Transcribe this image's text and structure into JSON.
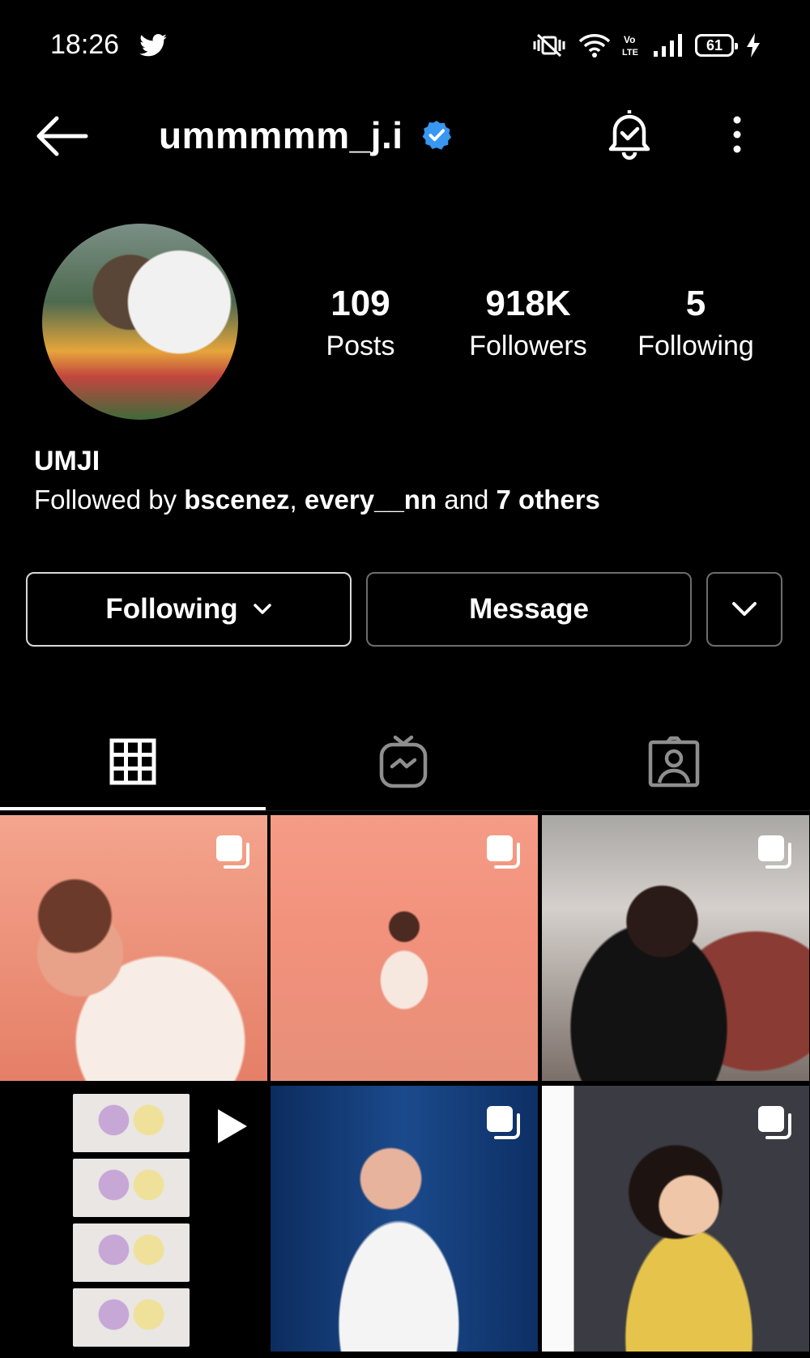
{
  "status_bar": {
    "time": "18:26",
    "battery": "61"
  },
  "header": {
    "username": "ummmmm_j.i"
  },
  "profile": {
    "stats": [
      {
        "value": "109",
        "label": "Posts"
      },
      {
        "value": "918K",
        "label": "Followers"
      },
      {
        "value": "5",
        "label": "Following"
      }
    ],
    "display_name": "UMJI",
    "followed_by": {
      "prefix": "Followed by ",
      "user1": "bscenez",
      "sep": ", ",
      "user2": "every__nn",
      "and": " and ",
      "others": "7 others"
    }
  },
  "actions": {
    "following_label": "Following",
    "message_label": "Message"
  },
  "tabs": [
    {
      "icon": "grid-icon",
      "selected": true
    },
    {
      "icon": "igtv-icon",
      "selected": false
    },
    {
      "icon": "tagged-icon",
      "selected": false
    }
  ],
  "posts": [
    {
      "type": "carousel"
    },
    {
      "type": "carousel"
    },
    {
      "type": "carousel"
    },
    {
      "type": "reel"
    },
    {
      "type": "carousel"
    },
    {
      "type": "carousel"
    }
  ],
  "colors": {
    "background": "#000000",
    "text": "#ffffff",
    "verified": "#3897f0",
    "border": "#8f8f8f"
  }
}
